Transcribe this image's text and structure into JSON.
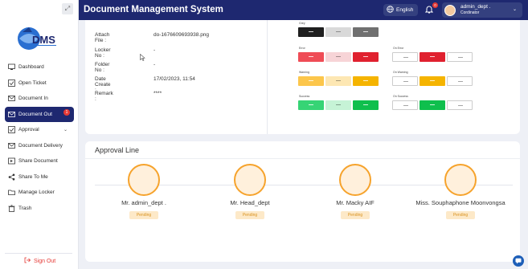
{
  "sidebar": {
    "items": [
      {
        "label": "Dashboard",
        "icon": "monitor-icon"
      },
      {
        "label": "Open Ticket",
        "icon": "checkbox-icon"
      },
      {
        "label": "Document In",
        "icon": "inbox-icon"
      },
      {
        "label": "Document Out",
        "icon": "mail-icon",
        "badge": "1"
      },
      {
        "label": "Approval",
        "icon": "checkbox-icon"
      },
      {
        "label": "Document Delivery",
        "icon": "mail-icon"
      },
      {
        "label": "Share Document",
        "icon": "share-document-icon"
      },
      {
        "label": "Share To Me",
        "icon": "share-icon"
      },
      {
        "label": "Manage Locker",
        "icon": "folder-icon"
      },
      {
        "label": "Trash",
        "icon": "trash-icon"
      }
    ],
    "signout_label": "Sign Out"
  },
  "header": {
    "title": "Document Management System",
    "language": "English",
    "notification_count": "0",
    "user_name": "admin_dept .",
    "user_role": "Cordinator"
  },
  "document": {
    "fields": [
      {
        "label": "Attach File :",
        "value": "do-1676609693938.png"
      },
      {
        "label": "Locker No :",
        "value": "-"
      },
      {
        "label": "Folder No :",
        "value": "-"
      },
      {
        "label": "Date Create :",
        "value": "17/02/2023, 11:54"
      },
      {
        "label": "Remark :",
        "value": "****"
      }
    ]
  },
  "swatches": {
    "gray_label": "Grey",
    "error_label": "Error",
    "on_error_label": "On Error",
    "warning_label": "Warning",
    "on_warning_label": "On Warning",
    "success_label": "Success",
    "on_success_label": "On Success",
    "colors": {
      "grey": [
        "#1f1f1f",
        "#d9d9d9",
        "#707070"
      ],
      "error": [
        "#ef4c56",
        "#f7d4d7",
        "#e0212f"
      ],
      "on_error": [
        "#ffffff",
        "#e0212f",
        "#ffffff"
      ],
      "warning": [
        "#fcc64b",
        "#fde7b3",
        "#f5b400"
      ],
      "on_warning": [
        "#ffffff",
        "#f5b400",
        "#ffffff"
      ],
      "success": [
        "#36d475",
        "#c6f3d6",
        "#0fbf4d"
      ],
      "on_success": [
        "#ffffff",
        "#0fbf4d",
        "#ffffff"
      ]
    }
  },
  "approval": {
    "title": "Approval Line",
    "approvers": [
      {
        "name": "Mr. admin_dept .",
        "status": "Pending"
      },
      {
        "name": "Mr. Head_dept",
        "status": "Pending"
      },
      {
        "name": "Mr. Macky AIF",
        "status": "Pending"
      },
      {
        "name": "Miss. Souphaphone Moonvongsa",
        "status": "Pending"
      }
    ]
  },
  "colors": {
    "primary": "#1e2870",
    "danger": "#e53935",
    "pending_bg": "#fde9c8",
    "pending_text": "#d8921f",
    "approver_ring": "#f6a32c"
  }
}
